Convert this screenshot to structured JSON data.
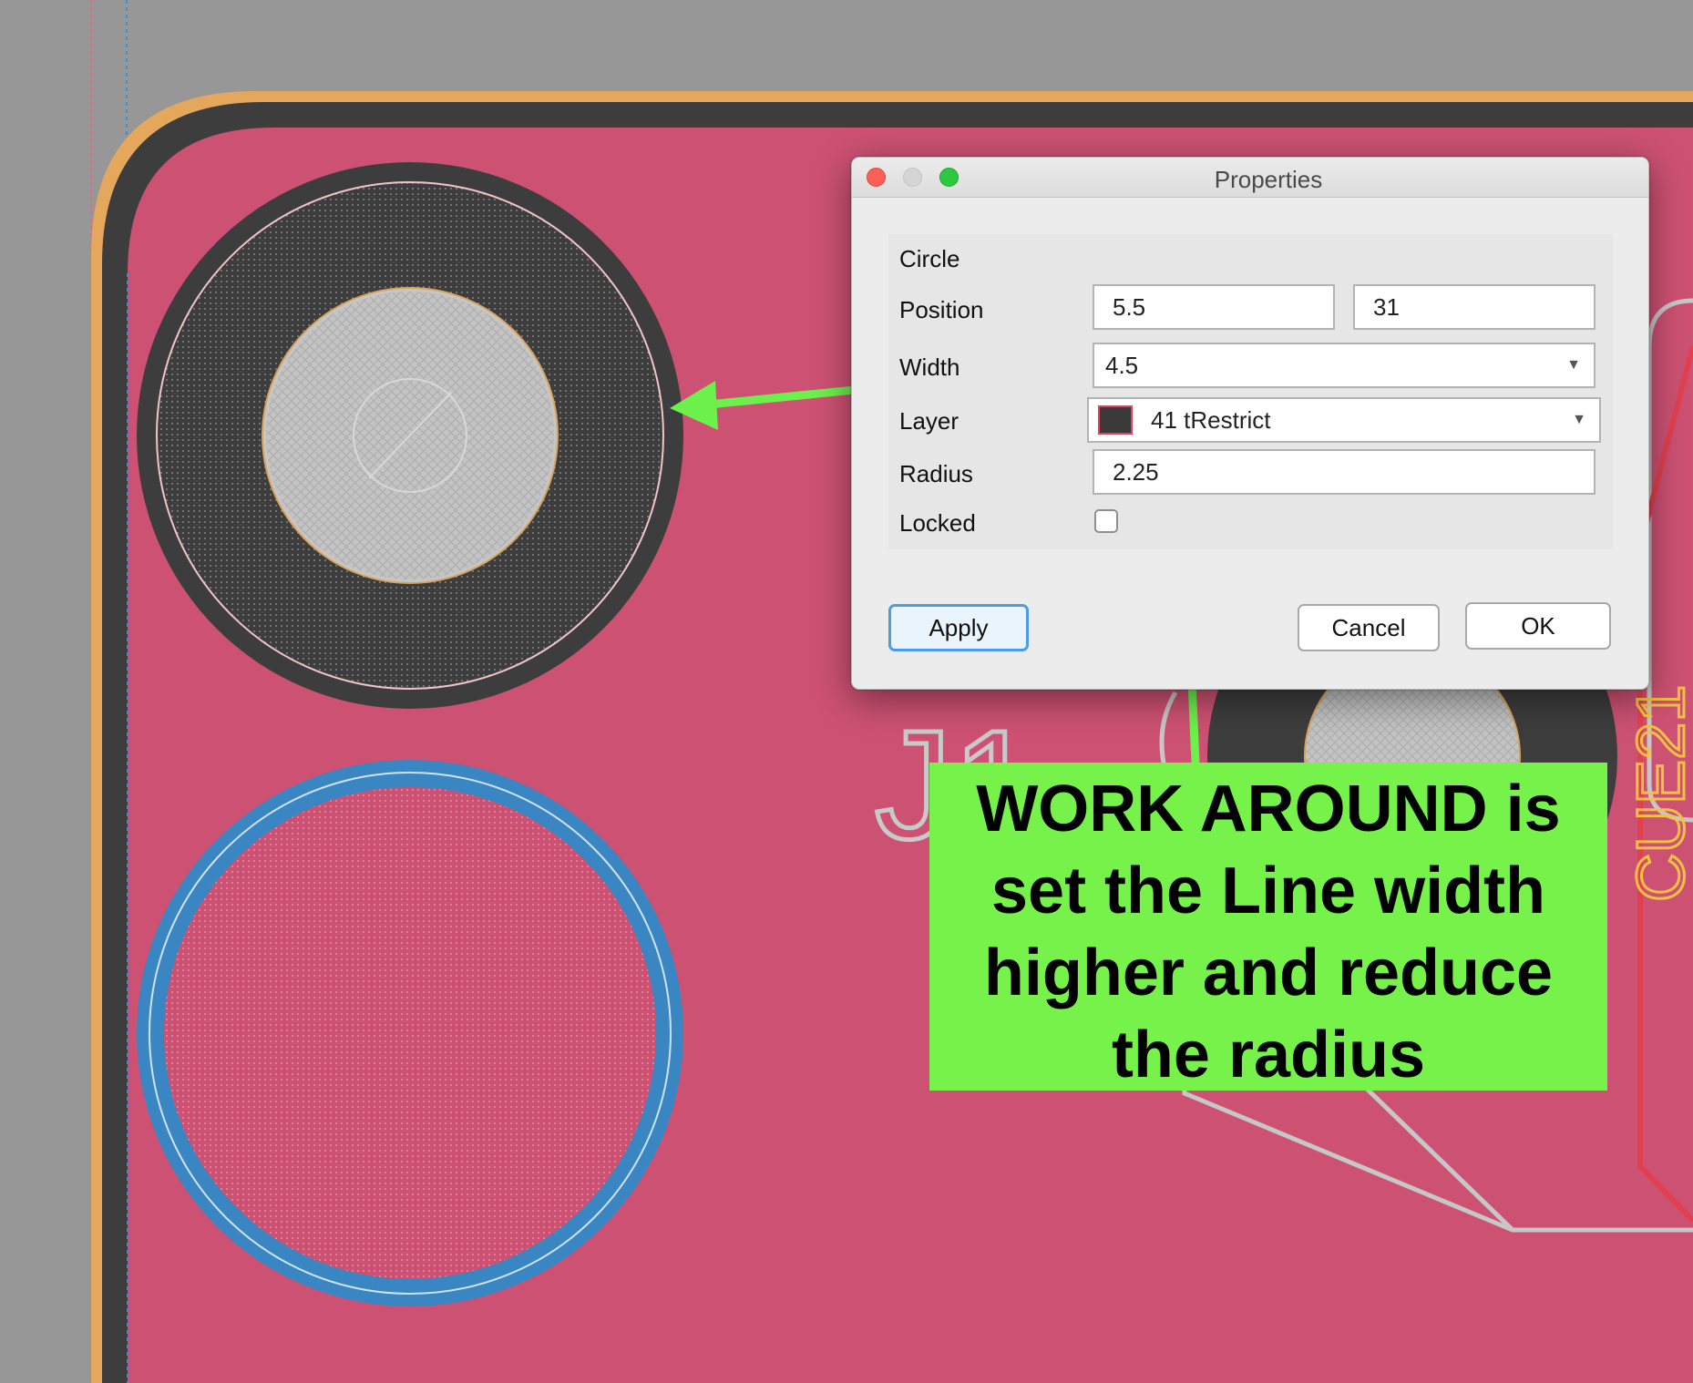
{
  "dialog": {
    "title": "Properties",
    "section": "Circle",
    "labels": {
      "position": "Position",
      "width": "Width",
      "layer": "Layer",
      "radius": "Radius",
      "locked": "Locked"
    },
    "position_x": "5.5",
    "position_y": "31",
    "width_value": "4.5",
    "layer_value": "41 tRestrict",
    "radius_value": "2.25",
    "locked_checked": false,
    "buttons": {
      "apply": "Apply",
      "cancel": "Cancel",
      "ok": "OK"
    }
  },
  "canvas": {
    "part_label": "J1",
    "part_label_right": "CUE21"
  },
  "annotation": {
    "lines": [
      "WORK AROUND is",
      "set the Line width",
      "higher and reduce",
      "the radius"
    ]
  },
  "colors": {
    "board": "#cd5173",
    "outline": "#e5a75c",
    "copper_restrict": "#3d3d3d",
    "pad_blue": "#3a86c2",
    "callout": "#76f24a",
    "arrow": "#6cf04c"
  }
}
